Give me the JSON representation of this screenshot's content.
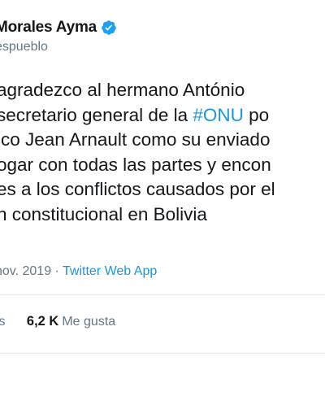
{
  "account": {
    "display_name": "Morales Ayma",
    "handle": "espueblo",
    "verified_icon": "verified-badge-icon",
    "verified_color": "#1da1f2"
  },
  "tweet": {
    "lines": [
      {
        "segments": [
          {
            "text": "agradezco al hermano António",
            "type": "text"
          }
        ]
      },
      {
        "segments": [
          {
            "text": "secretario general de la ",
            "type": "text"
          },
          {
            "text": "#ONU",
            "type": "hashtag"
          },
          {
            "text": " po",
            "type": "text"
          }
        ]
      },
      {
        "segments": [
          {
            "text": "ico Jean Arnault como su enviado",
            "type": "text"
          }
        ]
      },
      {
        "segments": [
          {
            "text": "ogar con todas las partes y encon",
            "type": "text"
          }
        ]
      },
      {
        "segments": [
          {
            "text": "es a los conflictos causados por el",
            "type": "text"
          }
        ]
      },
      {
        "segments": [
          {
            "text": "n constitucional en Bolivia",
            "type": "text"
          }
        ]
      }
    ]
  },
  "meta": {
    "date": "nov. 2019",
    "separator": " · ",
    "source": "Twitter Web App"
  },
  "stats": {
    "retweets_label": "ts",
    "likes_count": "6,2 K",
    "likes_label": "Me gusta"
  },
  "colors": {
    "link": "#1b95e0",
    "text": "#14171a",
    "muted": "#657786"
  }
}
